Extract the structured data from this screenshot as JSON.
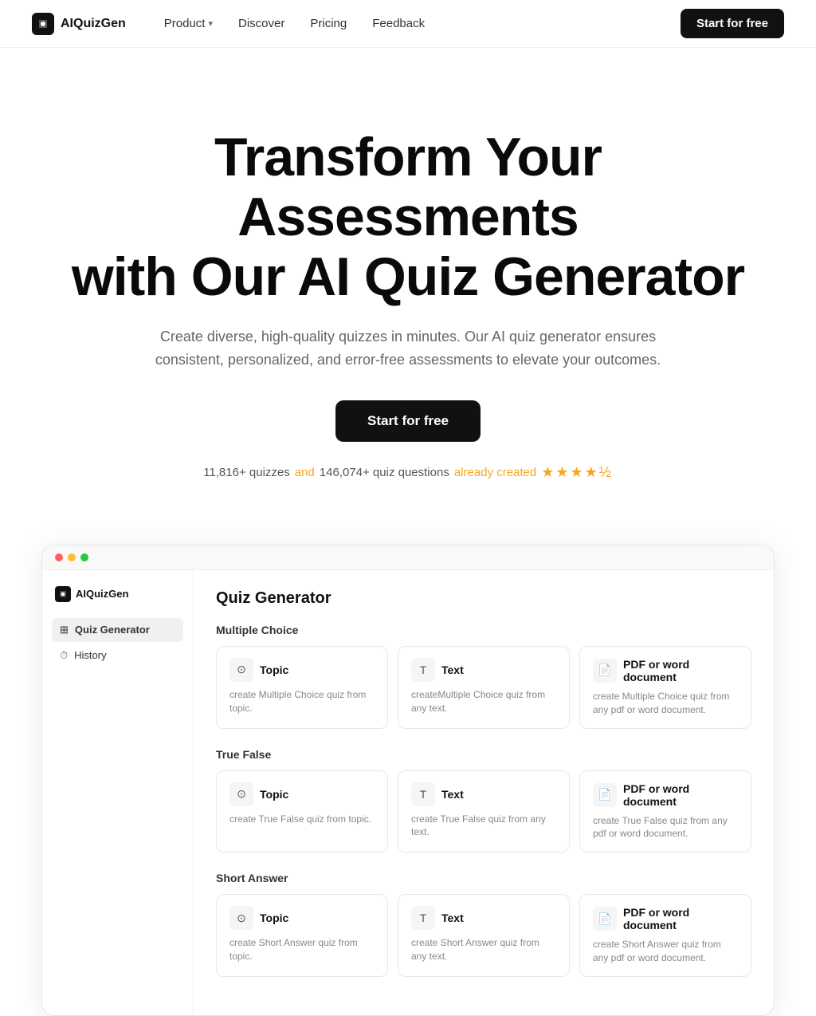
{
  "brand": {
    "name": "AIQuizGen",
    "logo_text": "AIQuizGen"
  },
  "nav": {
    "links": [
      {
        "id": "product",
        "label": "Product",
        "has_chevron": true
      },
      {
        "id": "discover",
        "label": "Discover",
        "has_chevron": false
      },
      {
        "id": "pricing",
        "label": "Pricing",
        "has_chevron": false
      },
      {
        "id": "feedback",
        "label": "Feedback",
        "has_chevron": false
      }
    ],
    "cta_label": "Start for free"
  },
  "hero": {
    "headline_line1": "Transform Your Assessments",
    "headline_line2": "with Our AI Quiz Generator",
    "subtext": "Create diverse, high-quality quizzes in minutes. Our AI quiz generator ensures consistent, personalized, and error-free assessments to elevate your outcomes.",
    "cta_label": "Start for free",
    "stats_prefix": "11,816+ quizzes",
    "stats_and": "and",
    "stats_middle": "146,074+ quiz questions",
    "stats_suffix": "already created",
    "stars": "★★★★½",
    "rating": "4.5"
  },
  "mockup": {
    "sidebar": {
      "brand": "AIQuizGen",
      "items": [
        {
          "id": "quiz-generator",
          "label": "Quiz Generator",
          "active": true
        },
        {
          "id": "history",
          "label": "History",
          "active": false
        }
      ]
    },
    "main": {
      "page_title": "Quiz Generator",
      "categories": [
        {
          "id": "multiple-choice",
          "title": "Multiple Choice",
          "cards": [
            {
              "id": "mc-topic",
              "icon": "⊙",
              "title": "Topic",
              "desc": "create Multiple Choice quiz from topic."
            },
            {
              "id": "mc-text",
              "icon": "T",
              "title": "Text",
              "desc": "createMultiple Choice quiz from any text."
            },
            {
              "id": "mc-pdf",
              "icon": "📄",
              "title": "PDF or word document",
              "desc": "create Multiple Choice quiz from any pdf or word document."
            }
          ]
        },
        {
          "id": "true-false",
          "title": "True False",
          "cards": [
            {
              "id": "tf-topic",
              "icon": "⊙",
              "title": "Topic",
              "desc": "create True False quiz from topic."
            },
            {
              "id": "tf-text",
              "icon": "T",
              "title": "Text",
              "desc": "create True False quiz from any text."
            },
            {
              "id": "tf-pdf",
              "icon": "📄",
              "title": "PDF or word document",
              "desc": "create True False quiz from any pdf or word document."
            }
          ]
        },
        {
          "id": "short-answer",
          "title": "Short Answer",
          "cards": [
            {
              "id": "sa-topic",
              "icon": "⊙",
              "title": "Topic",
              "desc": "create Short Answer quiz from topic."
            },
            {
              "id": "sa-text",
              "icon": "T",
              "title": "Text",
              "desc": "create Short Answer quiz from any text."
            },
            {
              "id": "sa-pdf",
              "icon": "📄",
              "title": "PDF or word document",
              "desc": "create Short Answer quiz from any pdf or word document."
            }
          ]
        }
      ]
    }
  }
}
